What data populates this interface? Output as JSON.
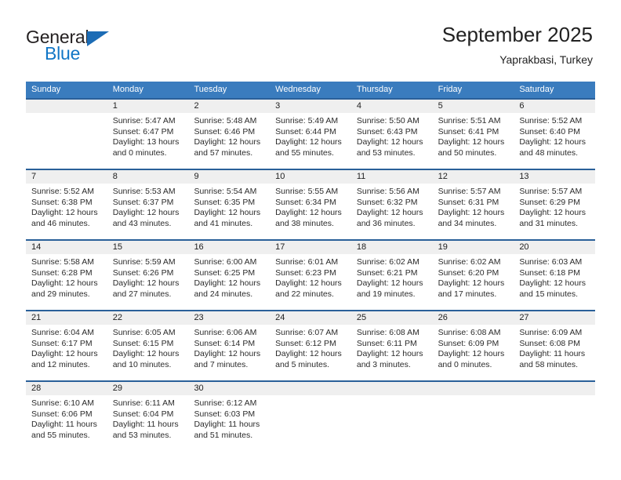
{
  "brand": {
    "name_top": "General",
    "name_bottom": "Blue",
    "accent_color": "#1c6cb5"
  },
  "header": {
    "title": "September 2025",
    "location": "Yaprakbasi, Turkey",
    "header_bg": "#3a7cbe",
    "week_border_color": "#2a6099",
    "daynum_band_color": "#efefef"
  },
  "weekdays": [
    "Sunday",
    "Monday",
    "Tuesday",
    "Wednesday",
    "Thursday",
    "Friday",
    "Saturday"
  ],
  "weeks": [
    [
      {
        "day": "",
        "empty": true,
        "l1": "",
        "l2": "",
        "l3": "",
        "l4": ""
      },
      {
        "day": "1",
        "l1": "Sunrise: 5:47 AM",
        "l2": "Sunset: 6:47 PM",
        "l3": "Daylight: 13 hours",
        "l4": "and 0 minutes."
      },
      {
        "day": "2",
        "l1": "Sunrise: 5:48 AM",
        "l2": "Sunset: 6:46 PM",
        "l3": "Daylight: 12 hours",
        "l4": "and 57 minutes."
      },
      {
        "day": "3",
        "l1": "Sunrise: 5:49 AM",
        "l2": "Sunset: 6:44 PM",
        "l3": "Daylight: 12 hours",
        "l4": "and 55 minutes."
      },
      {
        "day": "4",
        "l1": "Sunrise: 5:50 AM",
        "l2": "Sunset: 6:43 PM",
        "l3": "Daylight: 12 hours",
        "l4": "and 53 minutes."
      },
      {
        "day": "5",
        "l1": "Sunrise: 5:51 AM",
        "l2": "Sunset: 6:41 PM",
        "l3": "Daylight: 12 hours",
        "l4": "and 50 minutes."
      },
      {
        "day": "6",
        "l1": "Sunrise: 5:52 AM",
        "l2": "Sunset: 6:40 PM",
        "l3": "Daylight: 12 hours",
        "l4": "and 48 minutes."
      }
    ],
    [
      {
        "day": "7",
        "l1": "Sunrise: 5:52 AM",
        "l2": "Sunset: 6:38 PM",
        "l3": "Daylight: 12 hours",
        "l4": "and 46 minutes."
      },
      {
        "day": "8",
        "l1": "Sunrise: 5:53 AM",
        "l2": "Sunset: 6:37 PM",
        "l3": "Daylight: 12 hours",
        "l4": "and 43 minutes."
      },
      {
        "day": "9",
        "l1": "Sunrise: 5:54 AM",
        "l2": "Sunset: 6:35 PM",
        "l3": "Daylight: 12 hours",
        "l4": "and 41 minutes."
      },
      {
        "day": "10",
        "l1": "Sunrise: 5:55 AM",
        "l2": "Sunset: 6:34 PM",
        "l3": "Daylight: 12 hours",
        "l4": "and 38 minutes."
      },
      {
        "day": "11",
        "l1": "Sunrise: 5:56 AM",
        "l2": "Sunset: 6:32 PM",
        "l3": "Daylight: 12 hours",
        "l4": "and 36 minutes."
      },
      {
        "day": "12",
        "l1": "Sunrise: 5:57 AM",
        "l2": "Sunset: 6:31 PM",
        "l3": "Daylight: 12 hours",
        "l4": "and 34 minutes."
      },
      {
        "day": "13",
        "l1": "Sunrise: 5:57 AM",
        "l2": "Sunset: 6:29 PM",
        "l3": "Daylight: 12 hours",
        "l4": "and 31 minutes."
      }
    ],
    [
      {
        "day": "14",
        "l1": "Sunrise: 5:58 AM",
        "l2": "Sunset: 6:28 PM",
        "l3": "Daylight: 12 hours",
        "l4": "and 29 minutes."
      },
      {
        "day": "15",
        "l1": "Sunrise: 5:59 AM",
        "l2": "Sunset: 6:26 PM",
        "l3": "Daylight: 12 hours",
        "l4": "and 27 minutes."
      },
      {
        "day": "16",
        "l1": "Sunrise: 6:00 AM",
        "l2": "Sunset: 6:25 PM",
        "l3": "Daylight: 12 hours",
        "l4": "and 24 minutes."
      },
      {
        "day": "17",
        "l1": "Sunrise: 6:01 AM",
        "l2": "Sunset: 6:23 PM",
        "l3": "Daylight: 12 hours",
        "l4": "and 22 minutes."
      },
      {
        "day": "18",
        "l1": "Sunrise: 6:02 AM",
        "l2": "Sunset: 6:21 PM",
        "l3": "Daylight: 12 hours",
        "l4": "and 19 minutes."
      },
      {
        "day": "19",
        "l1": "Sunrise: 6:02 AM",
        "l2": "Sunset: 6:20 PM",
        "l3": "Daylight: 12 hours",
        "l4": "and 17 minutes."
      },
      {
        "day": "20",
        "l1": "Sunrise: 6:03 AM",
        "l2": "Sunset: 6:18 PM",
        "l3": "Daylight: 12 hours",
        "l4": "and 15 minutes."
      }
    ],
    [
      {
        "day": "21",
        "l1": "Sunrise: 6:04 AM",
        "l2": "Sunset: 6:17 PM",
        "l3": "Daylight: 12 hours",
        "l4": "and 12 minutes."
      },
      {
        "day": "22",
        "l1": "Sunrise: 6:05 AM",
        "l2": "Sunset: 6:15 PM",
        "l3": "Daylight: 12 hours",
        "l4": "and 10 minutes."
      },
      {
        "day": "23",
        "l1": "Sunrise: 6:06 AM",
        "l2": "Sunset: 6:14 PM",
        "l3": "Daylight: 12 hours",
        "l4": "and 7 minutes."
      },
      {
        "day": "24",
        "l1": "Sunrise: 6:07 AM",
        "l2": "Sunset: 6:12 PM",
        "l3": "Daylight: 12 hours",
        "l4": "and 5 minutes."
      },
      {
        "day": "25",
        "l1": "Sunrise: 6:08 AM",
        "l2": "Sunset: 6:11 PM",
        "l3": "Daylight: 12 hours",
        "l4": "and 3 minutes."
      },
      {
        "day": "26",
        "l1": "Sunrise: 6:08 AM",
        "l2": "Sunset: 6:09 PM",
        "l3": "Daylight: 12 hours",
        "l4": "and 0 minutes."
      },
      {
        "day": "27",
        "l1": "Sunrise: 6:09 AM",
        "l2": "Sunset: 6:08 PM",
        "l3": "Daylight: 11 hours",
        "l4": "and 58 minutes."
      }
    ],
    [
      {
        "day": "28",
        "l1": "Sunrise: 6:10 AM",
        "l2": "Sunset: 6:06 PM",
        "l3": "Daylight: 11 hours",
        "l4": "and 55 minutes."
      },
      {
        "day": "29",
        "l1": "Sunrise: 6:11 AM",
        "l2": "Sunset: 6:04 PM",
        "l3": "Daylight: 11 hours",
        "l4": "and 53 minutes."
      },
      {
        "day": "30",
        "l1": "Sunrise: 6:12 AM",
        "l2": "Sunset: 6:03 PM",
        "l3": "Daylight: 11 hours",
        "l4": "and 51 minutes."
      },
      {
        "day": "",
        "empty": true,
        "l1": "",
        "l2": "",
        "l3": "",
        "l4": ""
      },
      {
        "day": "",
        "empty": true,
        "l1": "",
        "l2": "",
        "l3": "",
        "l4": ""
      },
      {
        "day": "",
        "empty": true,
        "l1": "",
        "l2": "",
        "l3": "",
        "l4": ""
      },
      {
        "day": "",
        "empty": true,
        "l1": "",
        "l2": "",
        "l3": "",
        "l4": ""
      }
    ]
  ]
}
